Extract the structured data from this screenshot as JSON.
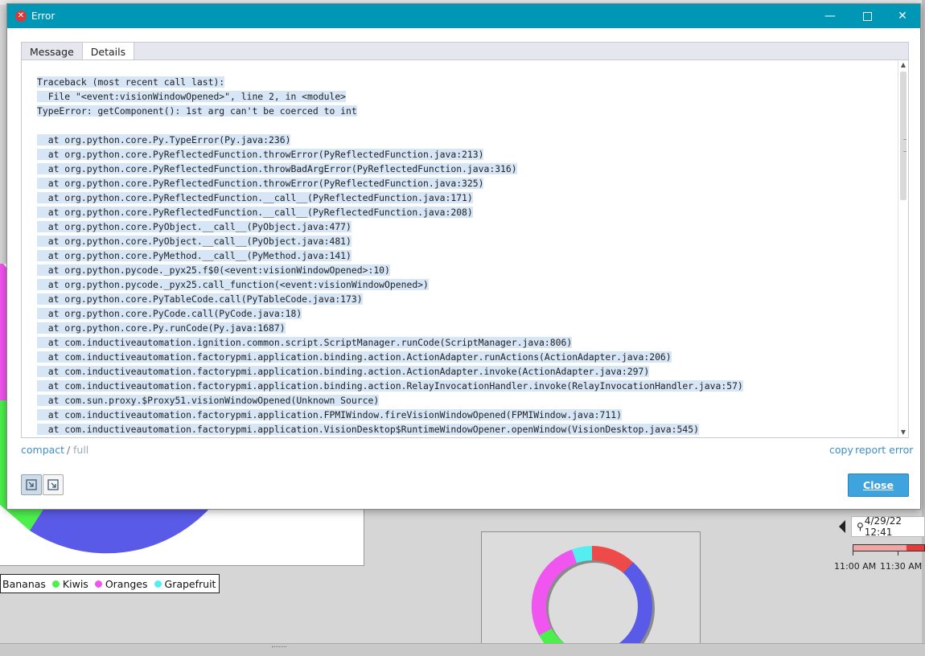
{
  "dialog": {
    "title": "Error",
    "window_controls": [
      "minimize-icon",
      "maximize-icon",
      "close-icon"
    ],
    "tabs": [
      {
        "label": "Message",
        "active": false
      },
      {
        "label": "Details",
        "active": true
      }
    ],
    "trace_lines": [
      "Traceback (most recent call last):",
      "  File \"<event:visionWindowOpened>\", line 2, in <module>",
      "TypeError: getComponent(): 1st arg can't be coerced to int",
      "",
      "  at org.python.core.Py.TypeError(Py.java:236)",
      "  at org.python.core.PyReflectedFunction.throwError(PyReflectedFunction.java:213)",
      "  at org.python.core.PyReflectedFunction.throwBadArgError(PyReflectedFunction.java:316)",
      "  at org.python.core.PyReflectedFunction.throwError(PyReflectedFunction.java:325)",
      "  at org.python.core.PyReflectedFunction.__call__(PyReflectedFunction.java:171)",
      "  at org.python.core.PyReflectedFunction.__call__(PyReflectedFunction.java:208)",
      "  at org.python.core.PyObject.__call__(PyObject.java:477)",
      "  at org.python.core.PyObject.__call__(PyObject.java:481)",
      "  at org.python.core.PyMethod.__call__(PyMethod.java:141)",
      "  at org.python.pycode._pyx25.f$0(<event:visionWindowOpened>:10)",
      "  at org.python.pycode._pyx25.call_function(<event:visionWindowOpened>)",
      "  at org.python.core.PyTableCode.call(PyTableCode.java:173)",
      "  at org.python.core.PyCode.call(PyCode.java:18)",
      "  at org.python.core.Py.runCode(Py.java:1687)",
      "  at com.inductiveautomation.ignition.common.script.ScriptManager.runCode(ScriptManager.java:806)",
      "  at com.inductiveautomation.factorypmi.application.binding.action.ActionAdapter.runActions(ActionAdapter.java:206)",
      "  at com.inductiveautomation.factorypmi.application.binding.action.ActionAdapter.invoke(ActionAdapter.java:297)",
      "  at com.inductiveautomation.factorypmi.application.binding.action.RelayInvocationHandler.invoke(RelayInvocationHandler.java:57)",
      "  at com.sun.proxy.$Proxy51.visionWindowOpened(Unknown Source)",
      "  at com.inductiveautomation.factorypmi.application.FPMIWindow.fireVisionWindowOpened(FPMIWindow.java:711)",
      "  at com.inductiveautomation.factorypmi.application.VisionDesktop$RuntimeWindowOpener.openWindow(VisionDesktop.java:545)"
    ],
    "view_mode": {
      "compact": "compact",
      "separator": "/",
      "full": "full"
    },
    "links": {
      "copy": "copy",
      "report": "report error"
    },
    "close_label": "Close"
  },
  "background": {
    "legend": [
      {
        "label": "Bananas",
        "color": "#f5d000"
      },
      {
        "label": "Kiwis",
        "color": "#4cf04c"
      },
      {
        "label": "Oranges",
        "color": "#f055f0"
      },
      {
        "label": "Grapefruit",
        "color": "#55eef0"
      }
    ],
    "timestamp": "4/29/22 12:41",
    "time_labels": [
      "11:00 AM",
      "11:30 AM"
    ]
  },
  "colors": {
    "titlebar": "#0096b6",
    "accent": "#3fa3dd",
    "selection": "#d6e6f7"
  }
}
